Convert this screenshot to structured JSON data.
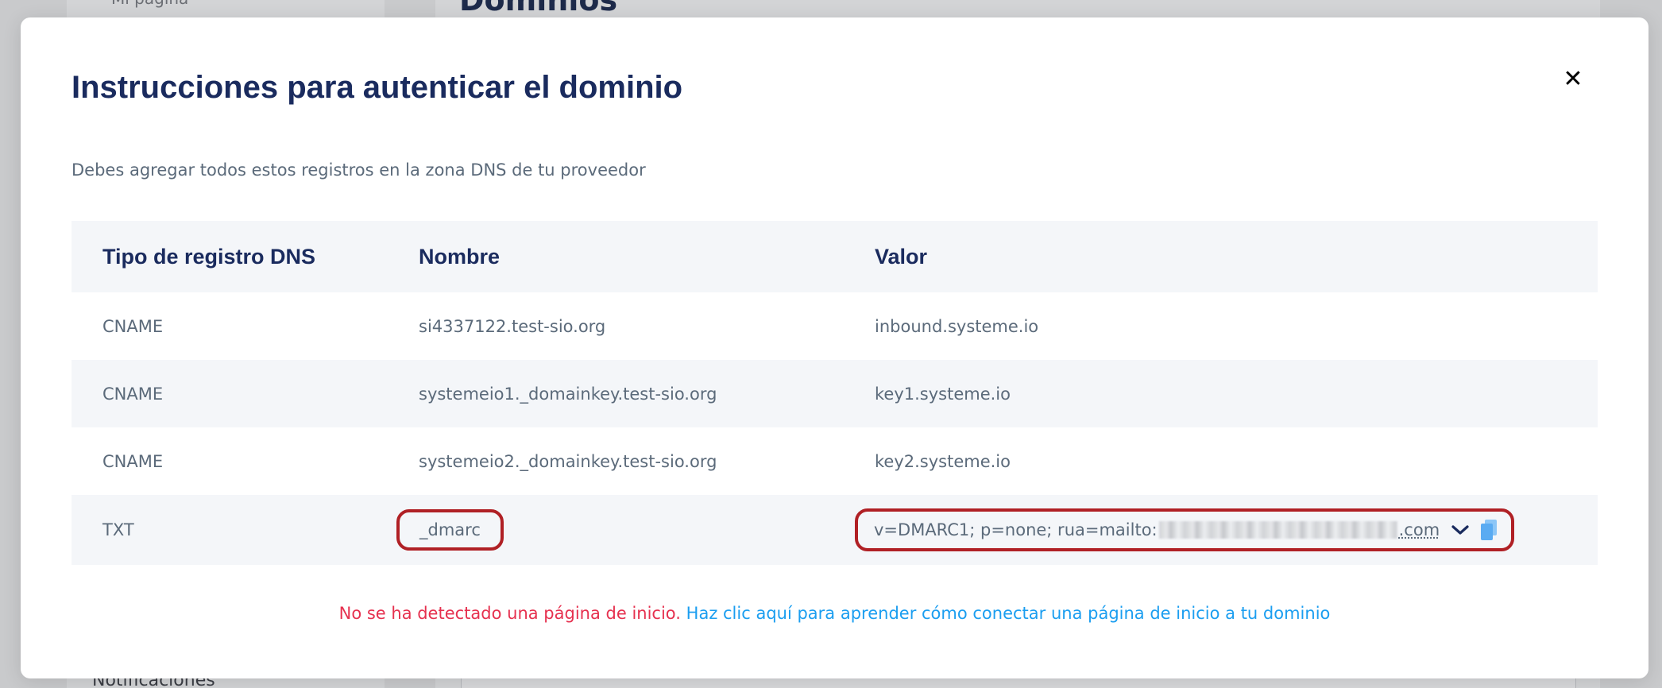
{
  "background": {
    "sidebar_top": "Mi página",
    "sidebar_bottom": "Notificaciones",
    "main_title": "Dominios"
  },
  "modal": {
    "title": "Instrucciones para autenticar el dominio",
    "close_icon": "close-icon",
    "subtitle": "Debes agregar todos estos registros en la zona DNS de tu proveedor"
  },
  "table": {
    "headers": {
      "type": "Tipo de registro DNS",
      "name": "Nombre",
      "value": "Valor"
    },
    "rows": [
      {
        "type": "CNAME",
        "name": "si4337122.test-sio.org",
        "value": "inbound.systeme.io"
      },
      {
        "type": "CNAME",
        "name": "systemeio1._domainkey.test-sio.org",
        "value": "key1.systeme.io"
      },
      {
        "type": "CNAME",
        "name": "systemeio2._domainkey.test-sio.org",
        "value": "key2.systeme.io"
      },
      {
        "type": "TXT",
        "name": "_dmarc",
        "value_prefix": "v=DMARC1; p=none; rua=mailto:",
        "value_suffix": ".com"
      }
    ]
  },
  "footer": {
    "warning": "No se ha detectado una página de inicio.",
    "link": "Haz clic aquí para aprender cómo conectar una página de inicio a tu dominio"
  },
  "colors": {
    "title": "#1a2b5e",
    "highlight": "#b02025",
    "warning": "#e6314f",
    "link": "#1b9ef0",
    "copy_icon": "#5aabf2"
  }
}
